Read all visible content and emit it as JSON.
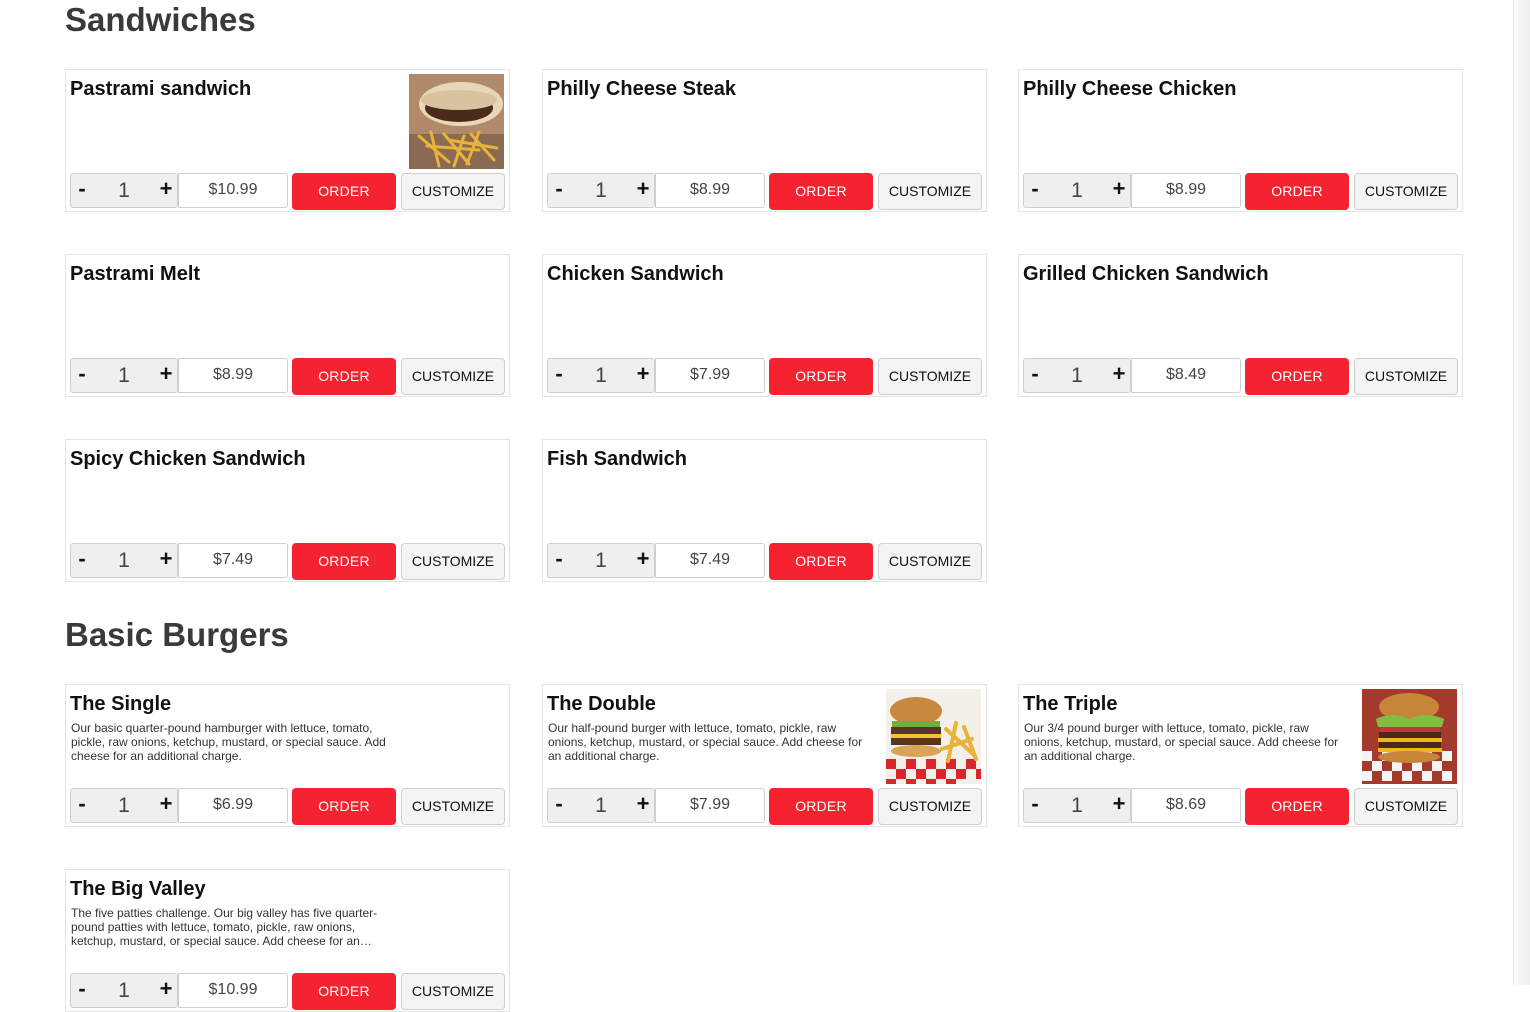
{
  "sections": [
    {
      "title": "Sandwiches",
      "items": [
        {
          "name": "Pastrami sandwich",
          "description": "",
          "qty": "1",
          "price": "$10.99",
          "order_label": "ORDER",
          "customize_label": "CUSTOMIZE",
          "image": "pastrami-photo"
        },
        {
          "name": "Philly Cheese Steak",
          "description": "",
          "qty": "1",
          "price": "$8.99",
          "order_label": "ORDER",
          "customize_label": "CUSTOMIZE"
        },
        {
          "name": "Philly Cheese Chicken",
          "description": "",
          "qty": "1",
          "price": "$8.99",
          "order_label": "ORDER",
          "customize_label": "CUSTOMIZE"
        },
        {
          "name": "Pastrami Melt",
          "description": "",
          "qty": "1",
          "price": "$8.99",
          "order_label": "ORDER",
          "customize_label": "CUSTOMIZE"
        },
        {
          "name": "Chicken Sandwich",
          "description": "",
          "qty": "1",
          "price": "$7.99",
          "order_label": "ORDER",
          "customize_label": "CUSTOMIZE"
        },
        {
          "name": "Grilled Chicken Sandwich",
          "description": "",
          "qty": "1",
          "price": "$8.49",
          "order_label": "ORDER",
          "customize_label": "CUSTOMIZE"
        },
        {
          "name": "Spicy Chicken Sandwich",
          "description": "",
          "qty": "1",
          "price": "$7.49",
          "order_label": "ORDER",
          "customize_label": "CUSTOMIZE"
        },
        {
          "name": "Fish Sandwich",
          "description": "",
          "qty": "1",
          "price": "$7.49",
          "order_label": "ORDER",
          "customize_label": "CUSTOMIZE"
        }
      ]
    },
    {
      "title": "Basic Burgers",
      "items": [
        {
          "name": "The Single",
          "description": "Our basic quarter-pound hamburger with lettuce, tomato, pickle, raw onions, ketchup, mustard, or special sauce. Add cheese for an additional charge.",
          "qty": "1",
          "price": "$6.99",
          "order_label": "ORDER",
          "customize_label": "CUSTOMIZE"
        },
        {
          "name": "The Double",
          "description": "Our half-pound burger with lettuce, tomato, pickle, raw onions, ketchup, mustard, or special sauce. Add cheese for an additional charge.",
          "qty": "1",
          "price": "$7.99",
          "order_label": "ORDER",
          "customize_label": "CUSTOMIZE",
          "image": "double-burger-photo"
        },
        {
          "name": "The Triple",
          "description": "Our 3/4 pound burger with lettuce, tomato, pickle, raw onions, ketchup, mustard, or special sauce. Add cheese for an additional charge.",
          "qty": "1",
          "price": "$8.69",
          "order_label": "ORDER",
          "customize_label": "CUSTOMIZE",
          "image": "triple-burger-photo"
        },
        {
          "name": "The Big Valley",
          "description": "The five patties challenge. Our big valley has five quarter-pound patties with lettuce, tomato, pickle, raw onions, ketchup, mustard, or special sauce. Add cheese for an additional charge.",
          "qty": "1",
          "price": "$10.99",
          "order_label": "ORDER",
          "customize_label": "CUSTOMIZE"
        }
      ]
    }
  ],
  "controls": {
    "minus_symbol": "-",
    "plus_symbol": "+"
  },
  "colors": {
    "order_button": "#f4232f",
    "section_title": "#3a3a3a",
    "card_border": "#e4e4e4"
  }
}
